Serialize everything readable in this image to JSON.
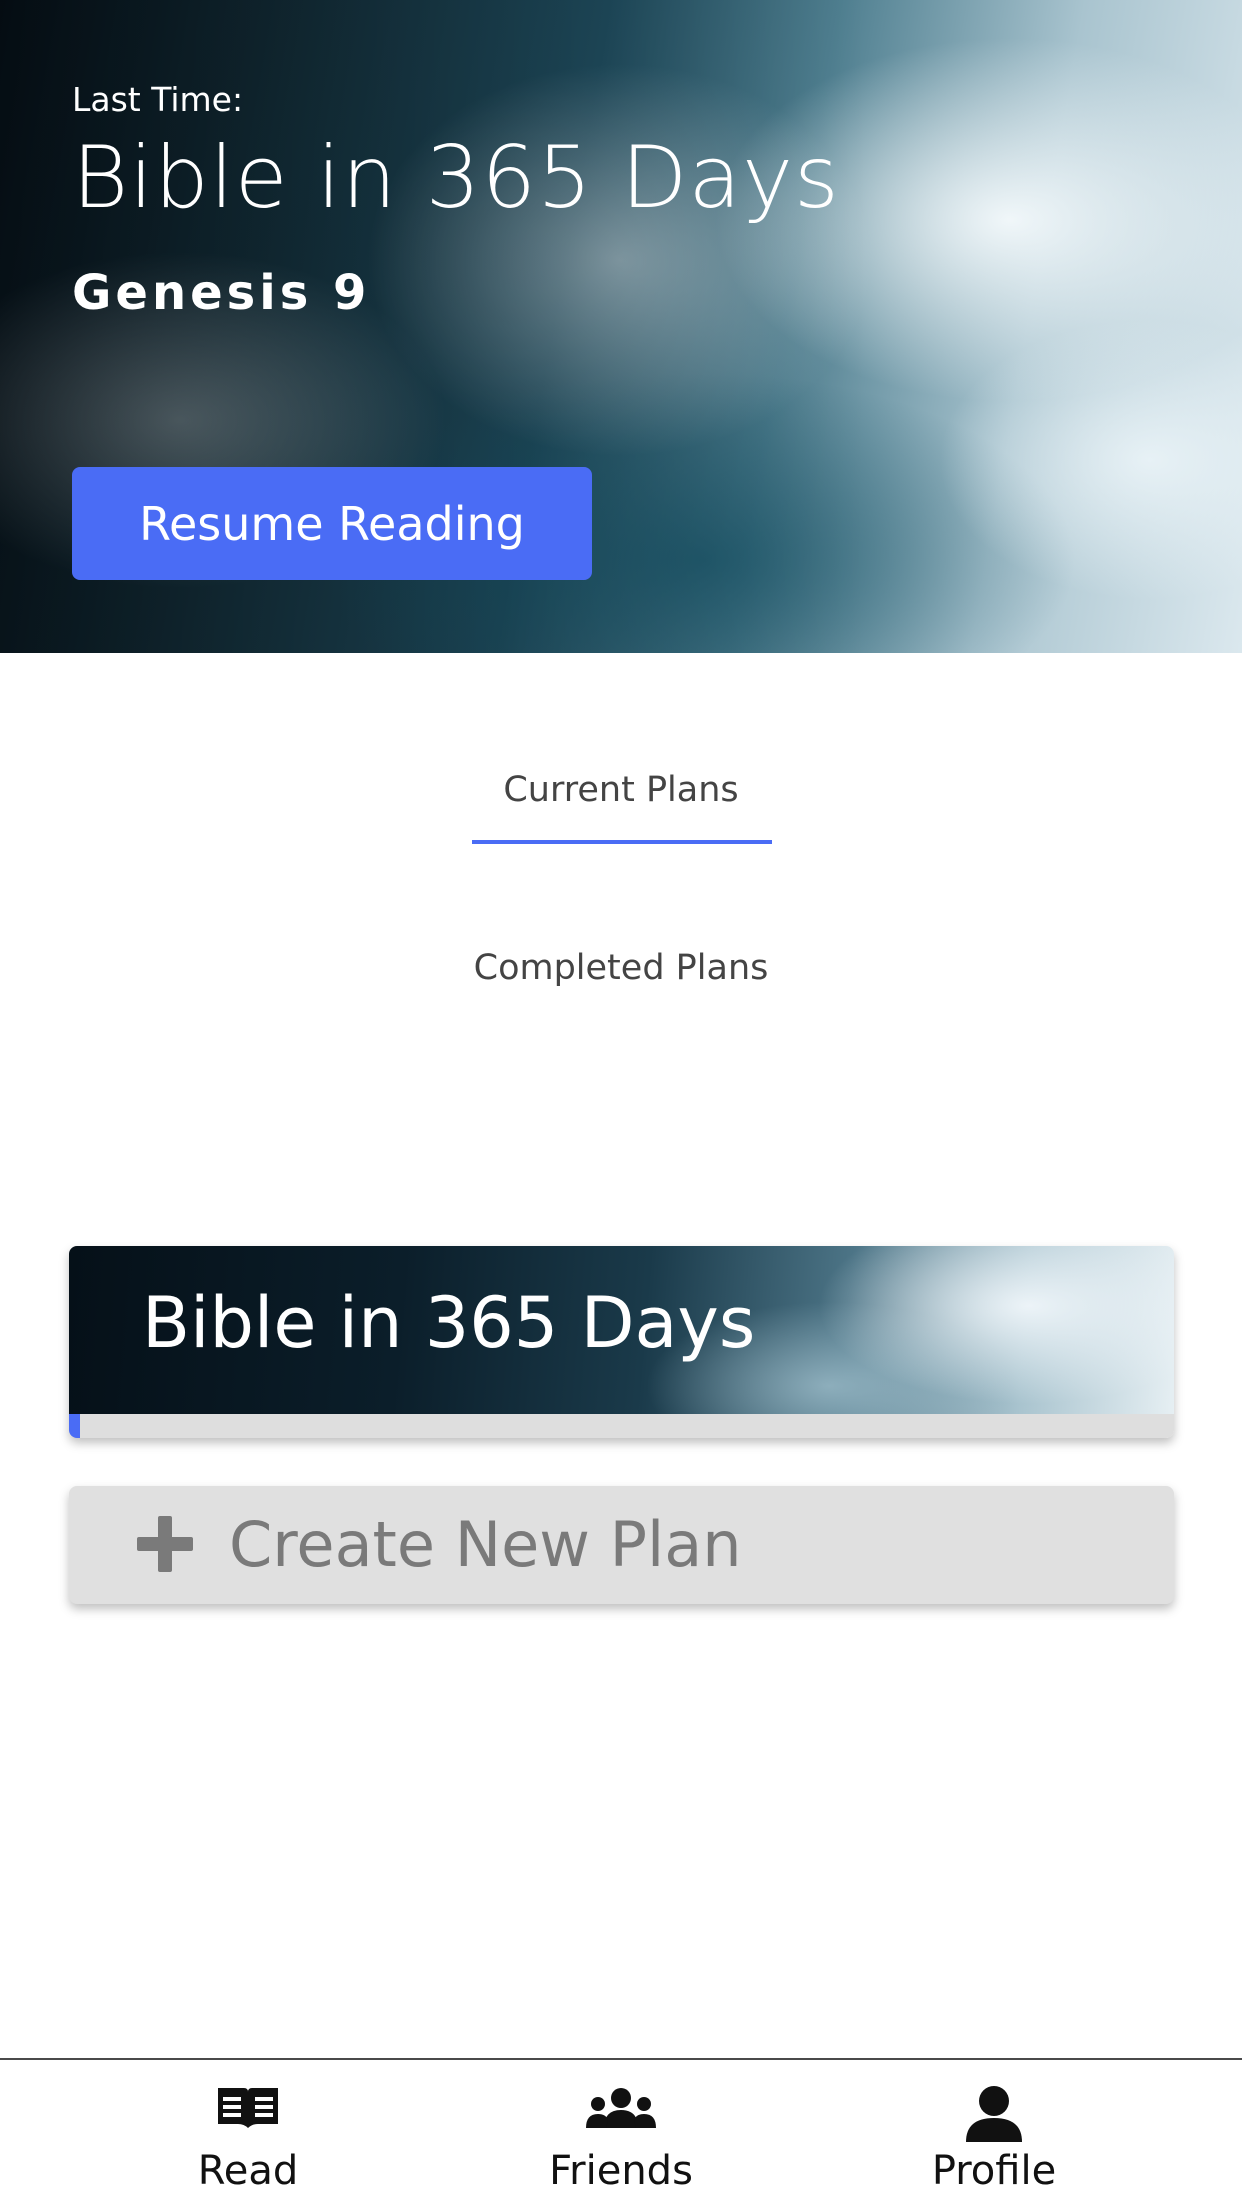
{
  "hero": {
    "last_time_label": "Last Time:",
    "plan_title": "Bible in 365 Days",
    "chapter": "Genesis 9",
    "resume_button_label": "Resume Reading"
  },
  "tabs": {
    "current_label": "Current Plans",
    "completed_label": "Completed Plans",
    "active": "current"
  },
  "plans": [
    {
      "title": "Bible in 365 Days",
      "progress_fraction": 0.01
    }
  ],
  "create_plan": {
    "label": "Create New Plan",
    "icon": "plus-icon"
  },
  "bottom_nav": {
    "items": [
      {
        "label": "Read",
        "icon": "book-icon"
      },
      {
        "label": "Friends",
        "icon": "users-icon"
      },
      {
        "label": "Profile",
        "icon": "user-icon"
      }
    ]
  },
  "colors": {
    "accent": "#4a6cf5",
    "muted_text": "#7a7a7a",
    "card_gray": "#e0e0e0"
  }
}
